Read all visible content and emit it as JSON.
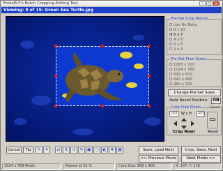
{
  "window": {
    "title": "PhotoELF's Batch Cropping-Editing Tool"
  },
  "viewing": {
    "text": "Viewing:  9 of 15: Green Sea Turtle.jpg"
  },
  "crop_ratios": {
    "legend": "Pre-Set Crop Ratios",
    "options": [
      "Use No Ratio",
      "8 x 10",
      "5 x 7",
      "4 x 6",
      "5 x 5",
      "3 x 4"
    ],
    "selected": "5 x 7"
  },
  "pixel_sizes": {
    "legend": "Pre-Set Pixel Sizes",
    "options": [
      "1280 x 720",
      "1024 x 768",
      "800 x 600",
      "640 x 480",
      "480 x 320"
    ]
  },
  "change_presets_label": "Change Pre-Set Sizes",
  "auto_recall": {
    "label": "Auto Recall Position:",
    "value": "ON"
  },
  "crop_size": {
    "legend": "Crop Size Pixels",
    "width_value": "568",
    "w_label": "W x H",
    "height_value": "406",
    "crop_now_label": "Crop Now!",
    "reset_label": "Reset",
    "speed_label": "Speed"
  },
  "toolbar": {
    "cancel_label": "Cancel",
    "tip_label": "Tip",
    "icons": [
      "pencil-icon",
      "wand-icon",
      "flip-horizontal-icon",
      "flip-vertical-icon",
      "rotate-left-icon",
      "rotate-right-icon",
      "copy-icon",
      "fit-icon",
      "contrast-icon",
      "move-icon",
      "grid-icon"
    ],
    "glyphs": [
      "✎",
      "✦",
      "⇄",
      "⇅",
      "↺",
      "↻",
      "▣",
      "▢",
      "◐",
      "✥",
      "▦"
    ]
  },
  "actions": {
    "save_load_next": "Save, Load Next",
    "crop_save_next": "Crop, Save, Next",
    "previous_photo": "<< Previous Photo",
    "next_photo": "Next Photo >>"
  },
  "statusbar": {
    "image_size": "1024 x 768 Pixels",
    "viewed_at": "Viewed at  51 %",
    "crop_size": "Crop Size: 568 x 406",
    "coords": "X: 307, Y: 178"
  },
  "colors": {
    "accent": "#1a3fc8",
    "canvas": "#061a6e",
    "handle": "#e21a1a"
  }
}
